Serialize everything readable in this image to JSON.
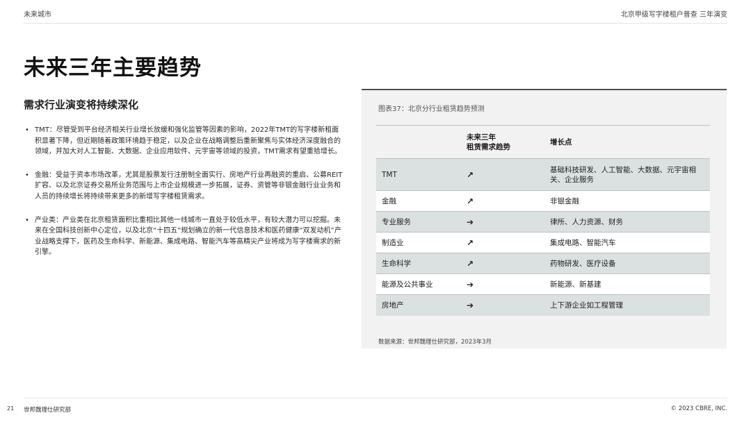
{
  "header": {
    "left": "未来城市",
    "right": "北京甲级写字楼租户普查 三年演变"
  },
  "title": "未来三年主要趋势",
  "subtitle": "需求行业演变将持续深化",
  "bullets": [
    "TMT：尽管受到平台经济相关行业增长放缓和强化监管等因素的影响，2022年TMT的写字楼新租面积显著下降，但近期随着政策环境趋于稳定，以及企业在战略调整后重新聚焦与实体经济深度融合的领域，并加大对人工智能、大数据、企业应用软件、元宇宙等领域的投资，TMT需求有望重拾增长。",
    "金融：受益于资本市场改革，尤其是股票发行注册制全面实行、房地产行业再融资的重启、公募REIT扩容、以及北京证券交易所业务范围与上市企业规模进一步拓展，证券、资管等非银金融行业业务和人员的持续增长将持续带来更多的新增写字楼租赁需求。",
    "产业类：产业类在北京租赁面积比重相比其他一线城市一直处于较低水平，有较大潜力可以挖掘。未来在全国科技创新中心定位，以及北京“十四五”规划确立的新一代信息技术和医药健康“双发动机”产业战略支撑下，医药及生命科学、新能源、集成电路、智能汽车等高精尖产业将成为写字楼需求的新引擎。"
  ],
  "bullet_marker": "•",
  "table": {
    "caption": "图表37：北京分行业租赁趋势预测",
    "headers": {
      "industry": "",
      "trend_line1": "未来三年",
      "trend_line2": "租赁需求趋势",
      "growth": "增长点"
    },
    "rows": [
      {
        "industry": "TMT",
        "trend": "↗",
        "trend_icon": "arrow-up-right-icon",
        "growth": "基础科技研发、人工智能、大数据、元宇宙相关、企业服务"
      },
      {
        "industry": "金融",
        "trend": "↗",
        "trend_icon": "arrow-up-right-icon",
        "growth": "非银金融"
      },
      {
        "industry": "专业服务",
        "trend": "➔",
        "trend_icon": "arrow-right-icon",
        "growth": "律所、人力资源、财务"
      },
      {
        "industry": "制造业",
        "trend": "↗",
        "trend_icon": "arrow-up-right-icon",
        "growth": "集成电路、智能汽车"
      },
      {
        "industry": "生命科学",
        "trend": "↗",
        "trend_icon": "arrow-up-right-icon",
        "growth": "药物研发、医疗设备"
      },
      {
        "industry": "能源及公共事业",
        "trend": "➔",
        "trend_icon": "arrow-right-icon",
        "growth": "新能源、新基建"
      },
      {
        "industry": "房地产",
        "trend": "➔",
        "trend_icon": "arrow-right-icon",
        "growth": "上下游企业如工程管理"
      }
    ],
    "source": "数据来源：世邦魏理仕研究部，2023年3月"
  },
  "footer": {
    "page_number": "21",
    "left": "世邦魏理仕研究部",
    "right": "© 2023 CBRE, INC."
  },
  "colors": {
    "panel_bg": "#f2f2f2",
    "row_shade": "#dbe1e0",
    "panel_border": "#435254"
  }
}
